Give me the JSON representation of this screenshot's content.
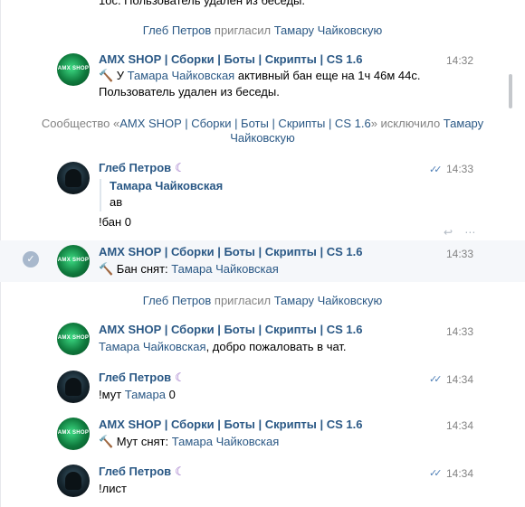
{
  "top_cut_text": "1ос. Пользователь удален из беседы.",
  "events": {
    "e1": {
      "actor": "Глеб Петров",
      "verb": "пригласил",
      "target": "Тамару Чайковскую"
    },
    "e2": {
      "pre": "Сообщество «",
      "community": "AMX SHOP | Сборки | Боты | Скрипты | CS 1.6",
      "mid": "» исключило ",
      "target": "Тамару",
      "target2": "Чайковскую"
    },
    "e3": {
      "actor": "Глеб Петров",
      "verb": "пригласил",
      "target": "Тамару Чайковскую"
    }
  },
  "amx_avatar_text": "AMX SHOP",
  "messages": {
    "m1": {
      "author": "AMX SHOP | Сборки | Боты | Скрипты | CS 1.6",
      "time": "14:32",
      "icon": "hammer-icon",
      "pre": " У ",
      "link": "Тамара Чайковская",
      "post": " активный бан еще на 1ч 46м 44с.",
      "line2": "Пользователь удален из беседы."
    },
    "m2": {
      "author": "Глеб Петров",
      "time": "14:33",
      "quote_name": "Тамара Чайковская",
      "quote_text": "ав",
      "text": "!бан 0"
    },
    "m3": {
      "author": "AMX SHOP | Сборки | Боты | Скрипты | CS 1.6",
      "time": "14:33",
      "pre": " Бан снят: ",
      "link": "Тамара Чайковская"
    },
    "m4": {
      "author": "AMX SHOP | Сборки | Боты | Скрипты | CS 1.6",
      "time": "14:33",
      "link": "Тамара Чайковская",
      "post": ", добро пожаловать в чат."
    },
    "m5": {
      "author": "Глеб Петров",
      "time": "14:34",
      "pre": "!мут ",
      "link": "Тамара",
      "post": " 0"
    },
    "m6": {
      "author": "AMX SHOP | Сборки | Боты | Скрипты | CS 1.6",
      "time": "14:34",
      "pre": " Мут снят: ",
      "link": "Тамара Чайковская"
    },
    "m7": {
      "author": "Глеб Петров",
      "time": "14:34",
      "text": "!лист"
    }
  },
  "glyphs": {
    "hammer": "🔨",
    "checks": "✓✓",
    "selected": "✓",
    "reply": "↩",
    "more": "⋯",
    "sticker": "☾"
  },
  "colors": {
    "link": "#2a5885",
    "service": "#828282",
    "read_checks": "#5181b8",
    "highlight": "#f5f7fa"
  }
}
